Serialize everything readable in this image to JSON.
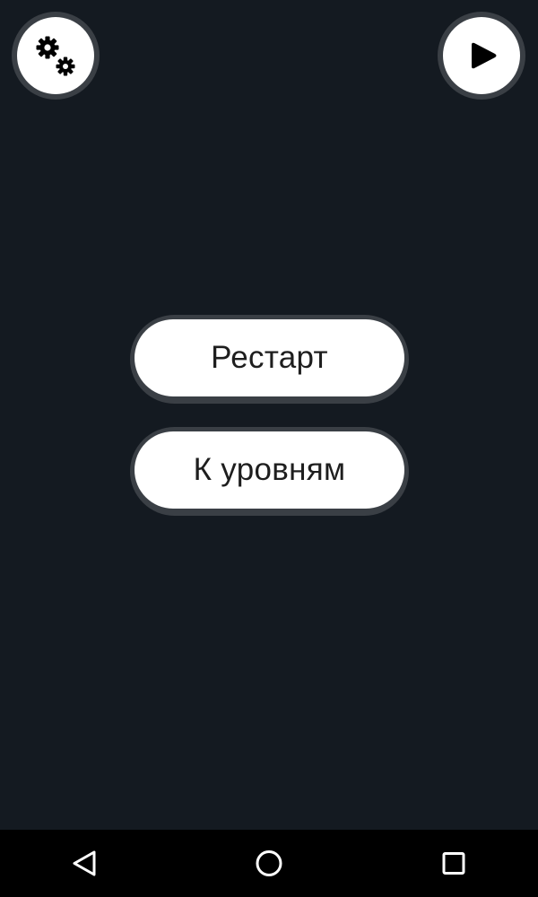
{
  "top_bar": {
    "settings_icon": "gears-icon",
    "play_icon": "play-icon"
  },
  "menu": {
    "restart_label": "Рестарт",
    "levels_label": "К уровням"
  },
  "nav_bar": {
    "back_icon": "back-triangle-icon",
    "home_icon": "home-circle-icon",
    "recents_icon": "recents-square-icon"
  },
  "colors": {
    "background": "#141a21",
    "button_fill": "#ffffff",
    "button_border": "#3a3f45",
    "text": "#1e1e1e",
    "nav_background": "#000000",
    "nav_icon": "#ffffff"
  }
}
